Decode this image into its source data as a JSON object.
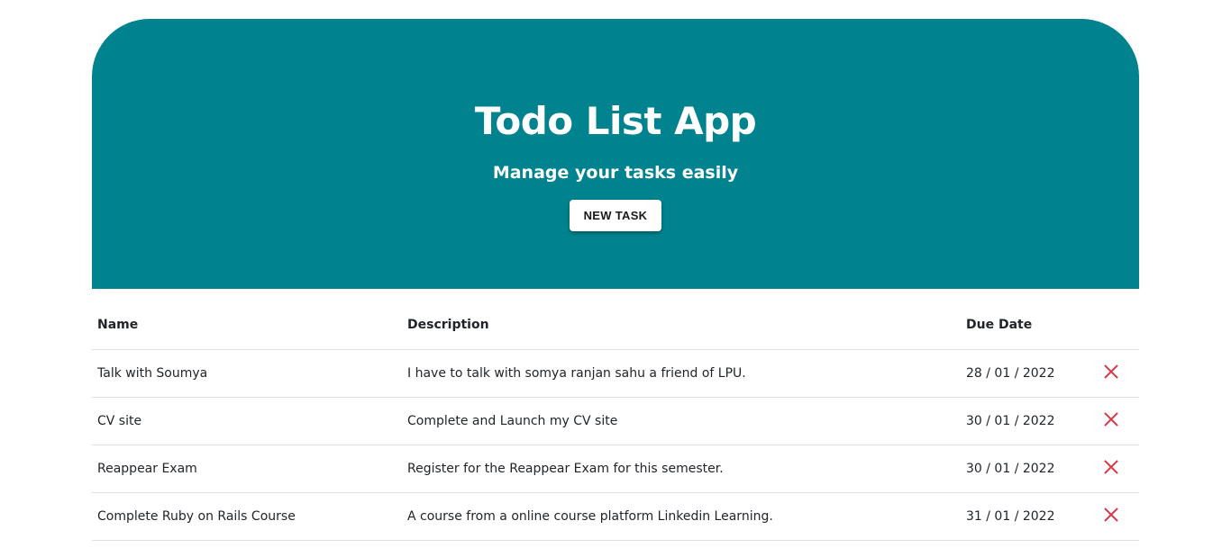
{
  "header": {
    "title": "Todo List App",
    "subtitle": "Manage your tasks easily",
    "new_task_label": "NEW TASK"
  },
  "table": {
    "columns": [
      "Name",
      "Description",
      "Due Date"
    ],
    "rows": [
      {
        "name": "Talk with Soumya",
        "description": "I have to talk with somya ranjan sahu a friend of LPU.",
        "due_date": "28 / 01 / 2022"
      },
      {
        "name": "CV site",
        "description": "Complete and Launch my CV site",
        "due_date": "30 / 01 / 2022"
      },
      {
        "name": "Reappear Exam",
        "description": "Register for the Reappear Exam for this semester.",
        "due_date": "30 / 01 / 2022"
      },
      {
        "name": "Complete Ruby on Rails Course",
        "description": "A course from a online course platform Linkedin Learning.",
        "due_date": "31 / 01 / 2022"
      }
    ]
  },
  "colors": {
    "hero_bg": "#00838f",
    "delete_icon": "#dc3545"
  },
  "icons": {
    "delete": "close-icon"
  }
}
